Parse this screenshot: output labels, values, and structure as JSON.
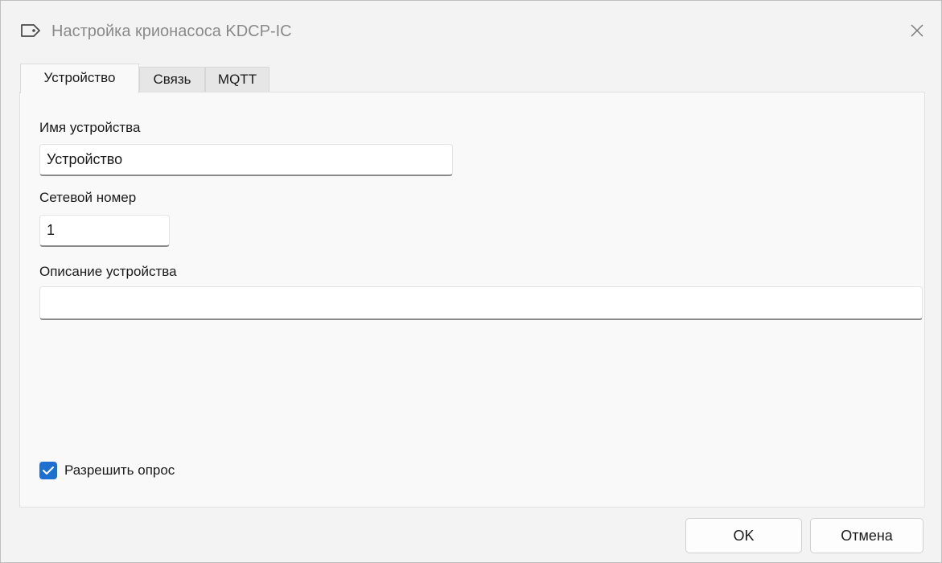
{
  "window": {
    "title": "Настройка крионасоса KDCP-IC",
    "app_icon": "tag-icon",
    "close_icon": "close-icon"
  },
  "tabs": [
    {
      "label": "Устройство",
      "active": true
    },
    {
      "label": "Связь",
      "active": false
    },
    {
      "label": "MQTT",
      "active": false
    }
  ],
  "form": {
    "device_name_label": "Имя устройства",
    "device_name_value": "Устройство",
    "network_number_label": "Сетевой номер",
    "network_number_value": "1",
    "description_label": "Описание устройства",
    "description_value": "",
    "enable_polling_label": "Разрешить опрос",
    "enable_polling_checked": true
  },
  "buttons": {
    "ok_label": "OK",
    "cancel_label": "Отмена"
  },
  "colors": {
    "accent": "#1f6fd1",
    "window_bg": "#f3f3f3",
    "panel_bg": "#f9f9f9"
  }
}
